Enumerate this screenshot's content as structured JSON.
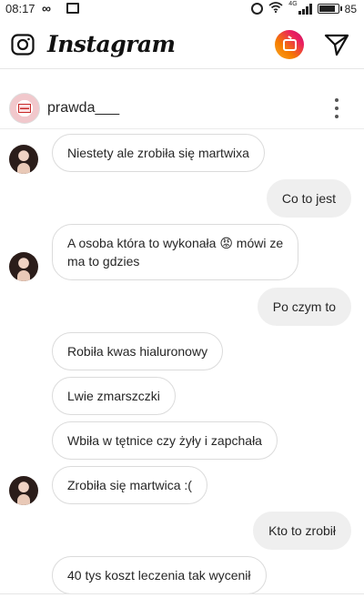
{
  "status_bar": {
    "time": "08:17",
    "left_icons": [
      "loop-icon",
      "image-icon"
    ],
    "right_icons": [
      "alarm-icon",
      "wifi-icon",
      "signal-icon",
      "battery-icon"
    ],
    "network_label": "4G",
    "battery": "85",
    "battery_level": 0.85
  },
  "top_bar": {
    "logo": "Instagram",
    "icons": [
      "camera-icon",
      "igtv-icon",
      "direct-send-icon"
    ],
    "igtv_gradient": [
      "#f9a825",
      "#e91e63"
    ]
  },
  "chat_header": {
    "username": "prawda___",
    "avatar_icon": "profile-avatar",
    "menu_icon": "more-vertical-icon"
  },
  "colors": {
    "incoming_bubble_border": "#dbdbdb",
    "outgoing_bubble_bg": "#efefef",
    "text": "#262626"
  },
  "messages": [
    {
      "direction": "in",
      "text": "Niestety ale zrobiła się martwixa",
      "show_avatar": true
    },
    {
      "direction": "out",
      "text": "Co to jest"
    },
    {
      "direction": "in",
      "lines": [
        "A osoba która to wykonała 😡 mówi ze",
        "ma to gdzies"
      ],
      "show_avatar": true
    },
    {
      "direction": "out",
      "text": "Po czym to"
    },
    {
      "direction": "in",
      "text": "Robiła kwas hialuronowy"
    },
    {
      "direction": "in",
      "text": "Lwie zmarszczki"
    },
    {
      "direction": "in",
      "text": "Wbiła w tętnice czy żyły i zapchała"
    },
    {
      "direction": "in",
      "text": "Zrobiła się martwica :(",
      "show_avatar": true
    },
    {
      "direction": "out",
      "text": "Kto to zrobił"
    },
    {
      "direction": "in",
      "text": "40 tys koszt leczenia tak wycenił"
    }
  ]
}
